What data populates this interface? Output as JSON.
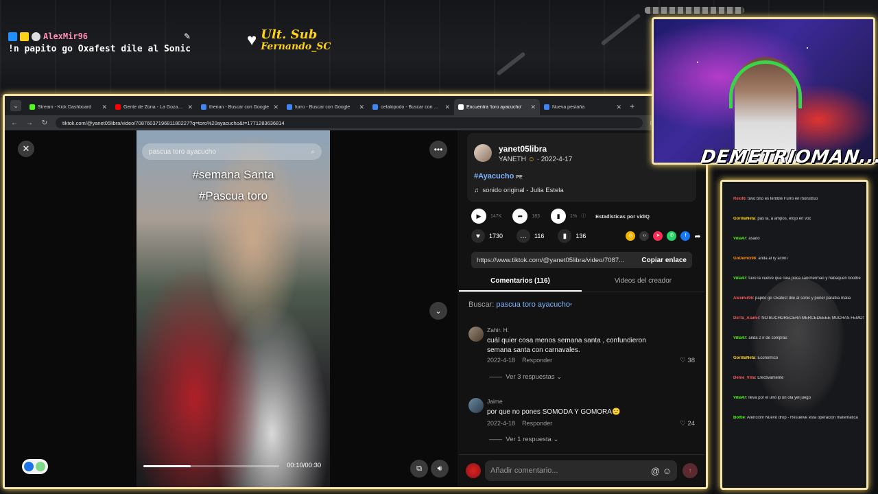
{
  "overlay": {
    "alert_user": "AlexMir96",
    "alert_message": "!n papito go Oxafest dile al Sonic",
    "sub_title": "Ult. Sub",
    "sub_name": "Fernando_SC",
    "streamer_name": "DEMETRIOMAN..."
  },
  "browser": {
    "tabs": [
      {
        "label": "Stream - Kick Dashboard",
        "color": "#53fc18"
      },
      {
        "label": "Gente de Zona - La Gozadera",
        "color": "#ff0000"
      },
      {
        "label": "therian - Buscar con Google",
        "color": "#4285f4"
      },
      {
        "label": "furro - Buscar con Google",
        "color": "#4285f4"
      },
      {
        "label": "cefalopodo - Buscar con Google",
        "color": "#4285f4"
      },
      {
        "label": "Encuentra 'toro ayacucho'",
        "color": "#ffffff"
      },
      {
        "label": "Nueva pestaña",
        "color": "#4285f4"
      }
    ],
    "url": "tiktok.com/@yanet05libra/video/7087603719681180227?q=toro%20ayacucho&t=1771283636814"
  },
  "video": {
    "search_text": "pascua toro ayacucho",
    "caption_1": "#semana Santa",
    "caption_2": "#Pascua toro",
    "time": "00:10/00:30",
    "progress_fraction": 0.35
  },
  "author": {
    "username": "yanet05libra",
    "display_name": "YANETH",
    "date": "2022-4-17",
    "hashtag": "#Ayacucho",
    "hashtag_suffix": "PE",
    "sound": "sonido original - Julia Estela"
  },
  "stats": {
    "views": "147K",
    "shares_small": "183",
    "percent": "1%",
    "vidiq_label": "Estadísticas por vidIQ",
    "likes": "1730",
    "comments": "116",
    "saves": "136"
  },
  "link": {
    "url": "https://www.tiktok.com/@yanet05libra/video/7087...",
    "copy_label": "Copiar enlace"
  },
  "tabs2": {
    "comments": "Comentarios (116)",
    "creator_videos": "Videos del creador"
  },
  "search_suggestion": {
    "prefix": "Buscar:",
    "query": "pascua toro ayacucho"
  },
  "comments": [
    {
      "user": "Zahir. H.",
      "text": "cuál quier cosa menos semana santa , confundieron semana santa con carnavales.",
      "date": "2022-4-18",
      "reply": "Responder",
      "likes": "38",
      "replies": "Ver 3 respuestas"
    },
    {
      "user": "Jaime",
      "text": "por que no pones SOMODA Y GOMORA🙂",
      "date": "2022-4-18",
      "reply": "Responder",
      "likes": "24",
      "replies": "Ver 1 respuesta"
    }
  ],
  "comment_bar": {
    "placeholder": "Añadir comentario..."
  },
  "chat_lines": [
    {
      "user": "Rexil6",
      "text": "tuvo bno es terrible Furro en monstruo",
      "color": "#ff5a5a"
    },
    {
      "user": "GorillaNeta",
      "text": "pas la, a ampos, etojo en voc",
      "color": "#ffd21a"
    },
    {
      "user": "Villa47",
      "text": "asado",
      "color": "#53fc18"
    },
    {
      "user": "GoDemix98",
      "text": "anda al ry acoru",
      "color": "#ff8c1a"
    },
    {
      "user": "Villa47",
      "text": "tuvo la vuelve que ceia poca sanchermao y habaquen boothe",
      "color": "#53fc18"
    },
    {
      "user": "Alexmir96",
      "text": "papito go Oxafest dile al sonic y poner paratlia malia",
      "color": "#ff5a5a"
    },
    {
      "user": "DelTa_Alamir",
      "text": "NO BUCHORECERA MERCEDEEEE MUCHAS FEMOS",
      "color": "#ff5a5a"
    },
    {
      "user": "Villa47",
      "text": "anda 2 ir de compras",
      "color": "#53fc18"
    },
    {
      "user": "GorillaNeta",
      "text": "Económico",
      "color": "#ffd21a"
    },
    {
      "user": "Deme_Villa",
      "text": "Efectivamente",
      "color": "#ff5a5a"
    },
    {
      "user": "Villa47",
      "text": "lleva por el uno ip un ola yel juego",
      "color": "#53fc18"
    },
    {
      "user": "Bottie",
      "text": "Atención! Nuevo drop - Resuelve esta operacion matematica",
      "color": "#53fc18"
    }
  ],
  "colors": {
    "frame_glow": "#f3e6a8",
    "tiktok_red": "#fe2c55",
    "link_blue": "#7fb4ff"
  }
}
